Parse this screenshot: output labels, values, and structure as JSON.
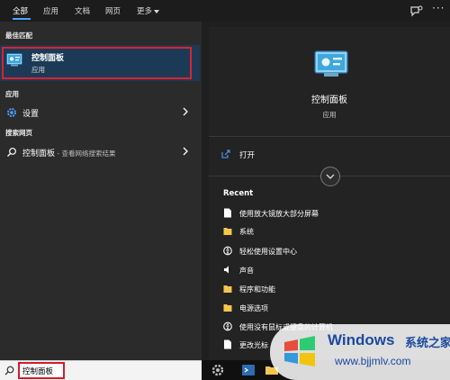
{
  "nav": {
    "tabs": [
      "全部",
      "应用",
      "文档",
      "网页",
      "更多"
    ],
    "feedback_icon": "feedback-icon",
    "more_icon": "more-options-icon"
  },
  "left": {
    "best_match_header": "最佳匹配",
    "best_match": {
      "title": "控制面板",
      "subtitle": "应用",
      "icon": "control-panel-icon"
    },
    "apps_header": "应用",
    "apps": [
      {
        "label": "设置",
        "icon": "gear-icon"
      }
    ],
    "web_header": "搜索网页",
    "web": [
      {
        "label": "控制面板",
        "suffix": " - 查看网络搜索结果",
        "icon": "search-icon"
      }
    ]
  },
  "right": {
    "title": "控制面板",
    "subtitle": "应用",
    "open_label": "打开",
    "recent_header": "Recent",
    "recent": [
      {
        "label": "使用放大镜放大部分屏幕",
        "icon": "document-icon"
      },
      {
        "label": "系统",
        "icon": "folder-icon"
      },
      {
        "label": "轻松使用设置中心",
        "icon": "accessibility-icon"
      },
      {
        "label": "声音",
        "icon": "speaker-icon"
      },
      {
        "label": "程序和功能",
        "icon": "folder-icon"
      },
      {
        "label": "电源选项",
        "icon": "folder-icon"
      },
      {
        "label": "使用没有鼠标或键盘的计算机",
        "icon": "accessibility-icon"
      },
      {
        "label": "更改光标",
        "icon": "document-icon"
      }
    ]
  },
  "search": {
    "value": "控制面板"
  },
  "watermark": {
    "title": "Windows",
    "cn": "系统之家",
    "url": "www.bjjmlv.com"
  },
  "colors": {
    "accent": "#4aa3ff",
    "selected": "#1c3a56",
    "highlight": "#e0202e",
    "watermark": "#1b4aa0"
  }
}
